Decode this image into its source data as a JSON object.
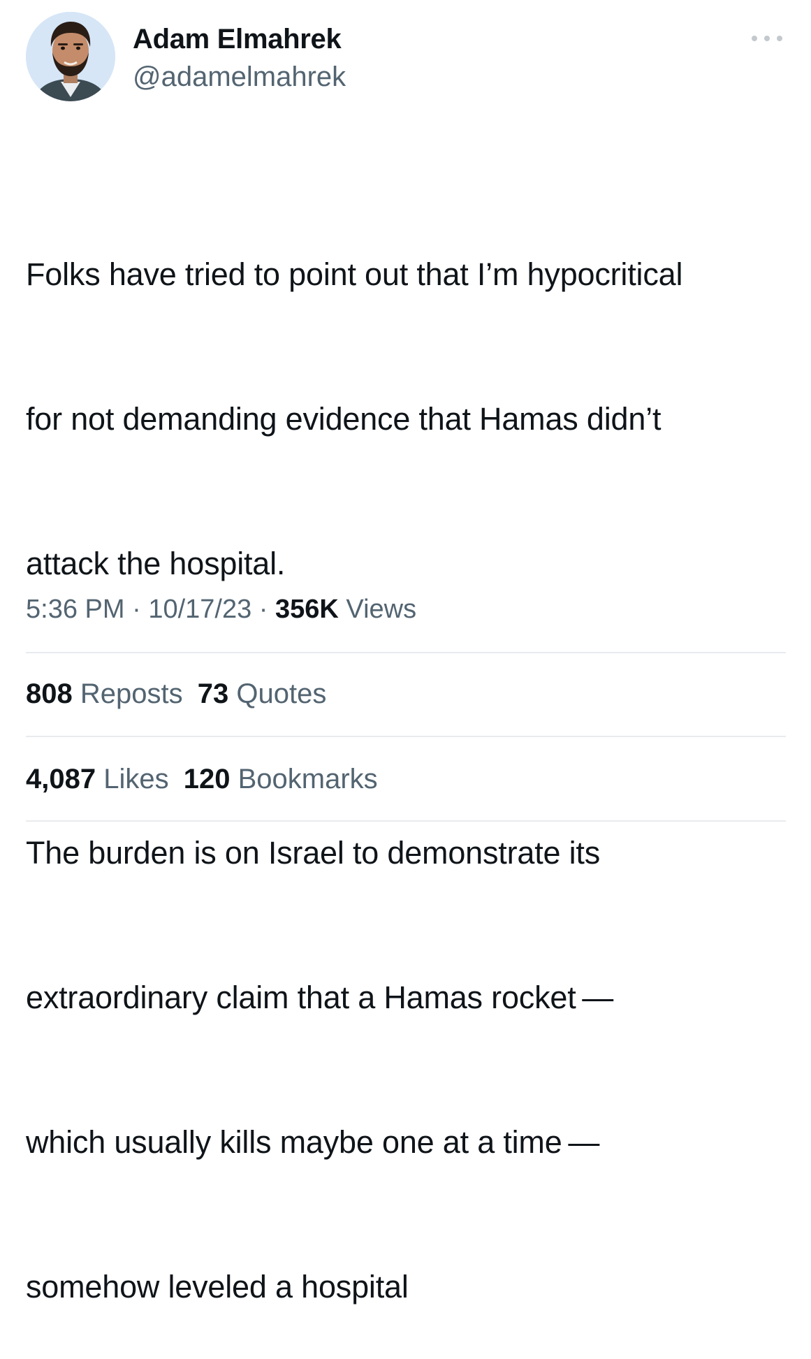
{
  "author": {
    "display_name": "Adam Elmahrek",
    "handle": "@adamelmahrek",
    "avatar_icon": "profile-photo"
  },
  "menu": {
    "more_icon": "ellipsis-icon"
  },
  "tweet": {
    "lines": [
      "Folks have tried to point out that I’m hypocritical",
      "for not demanding evidence that Hamas didn’t",
      "attack the hospital.",
      "",
      "The burden is on Israel to demonstrate its",
      "extraordinary claim that a Hamas rocket —",
      "which usually kills maybe one at a time —",
      "somehow leveled a hospital"
    ]
  },
  "meta": {
    "time": "5:36 PM",
    "separator": " · ",
    "date": "10/17/23",
    "views_count": "356K",
    "views_label": " Views"
  },
  "engagement": {
    "reposts_count": "808",
    "reposts_label": " Reposts",
    "quotes_count": "73",
    "quotes_label": " Quotes",
    "likes_count": "4,087",
    "likes_label": " Likes",
    "bookmarks_count": "120",
    "bookmarks_label": " Bookmarks"
  },
  "colors": {
    "text_primary": "#0f1419",
    "text_secondary": "#536471",
    "divider": "#e8ebed",
    "avatar_background": "#d6e6f7"
  }
}
